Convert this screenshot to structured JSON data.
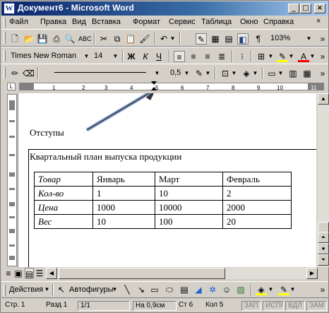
{
  "window": {
    "title": "Документ6 - Microsoft Word"
  },
  "menu": [
    "Файл",
    "Правка",
    "Вид",
    "Вставка",
    "Формат",
    "Сервис",
    "Таблица",
    "Окно",
    "Справка"
  ],
  "toolbar_standard": {
    "zoom": "103%"
  },
  "toolbar_formatting": {
    "font": "Times New Roman",
    "size": "14",
    "bold": "Ж",
    "italic": "К",
    "underline": "Ч"
  },
  "toolbar_border": {
    "line_weight": "0,5"
  },
  "ruler": {
    "ticks": [
      "1",
      "2",
      "3",
      "4",
      "5",
      "6",
      "7",
      "8",
      "9",
      "10",
      "11"
    ]
  },
  "document": {
    "caption": "Отступы",
    "heading": "Квартальный план выпуска продукции",
    "table": {
      "header": [
        "Товар",
        "Январь",
        "Март",
        "Февраль"
      ],
      "rows": [
        [
          "Кол-во",
          "1",
          "10",
          "2"
        ],
        [
          "Цена",
          "1000",
          "10000",
          "2000"
        ],
        [
          "Вес",
          "10",
          "100",
          "20"
        ]
      ]
    }
  },
  "drawing_toolbar": {
    "actions": "Действия",
    "autoshapes": "Автофигуры"
  },
  "status": {
    "page": "Стр. 1",
    "section": "Разд 1",
    "pages": "1/1",
    "at": "На 0,9см",
    "line": "Ст 6",
    "col": "Кол 5",
    "rec": "ЗАП",
    "trk": "ИСПР",
    "ext": "ВДЛ",
    "ovr": "ЗАМ"
  },
  "colors": {
    "title_bar": "#0a246a",
    "highlight": "#ffff00",
    "font_color": "#ff0000"
  }
}
